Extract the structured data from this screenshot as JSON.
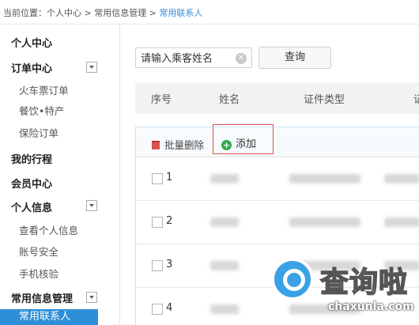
{
  "breadcrumb": {
    "prefix": "当前位置：",
    "items": [
      "个人中心",
      "常用信息管理"
    ],
    "separator": ">",
    "current": "常用联系人"
  },
  "sidebar": {
    "personal_center": "个人中心",
    "order_center": "订单中心",
    "order_items": [
      "火车票订单",
      "餐饮•特产",
      "保险订单"
    ],
    "my_trips": "我的行程",
    "member_center": "会员中心",
    "personal_info": "个人信息",
    "info_items": [
      "查看个人信息",
      "账号安全",
      "手机核验"
    ],
    "common_info": "常用信息管理",
    "active_item": "常用联系人"
  },
  "search": {
    "placeholder": "请输入乘客姓名",
    "query_label": "查询"
  },
  "table": {
    "headers": [
      "序号",
      "姓名",
      "证件类型",
      "证"
    ],
    "batch_delete_label": "批量删除",
    "add_label": "添加",
    "rows": [
      "1",
      "2",
      "3",
      "4"
    ]
  },
  "watermark": {
    "title": "查询啦",
    "url": "chaxunla.com"
  },
  "colors": {
    "accent": "#2e8fd8",
    "highlight_border": "#d9534f",
    "add_icon": "#31a94d"
  }
}
